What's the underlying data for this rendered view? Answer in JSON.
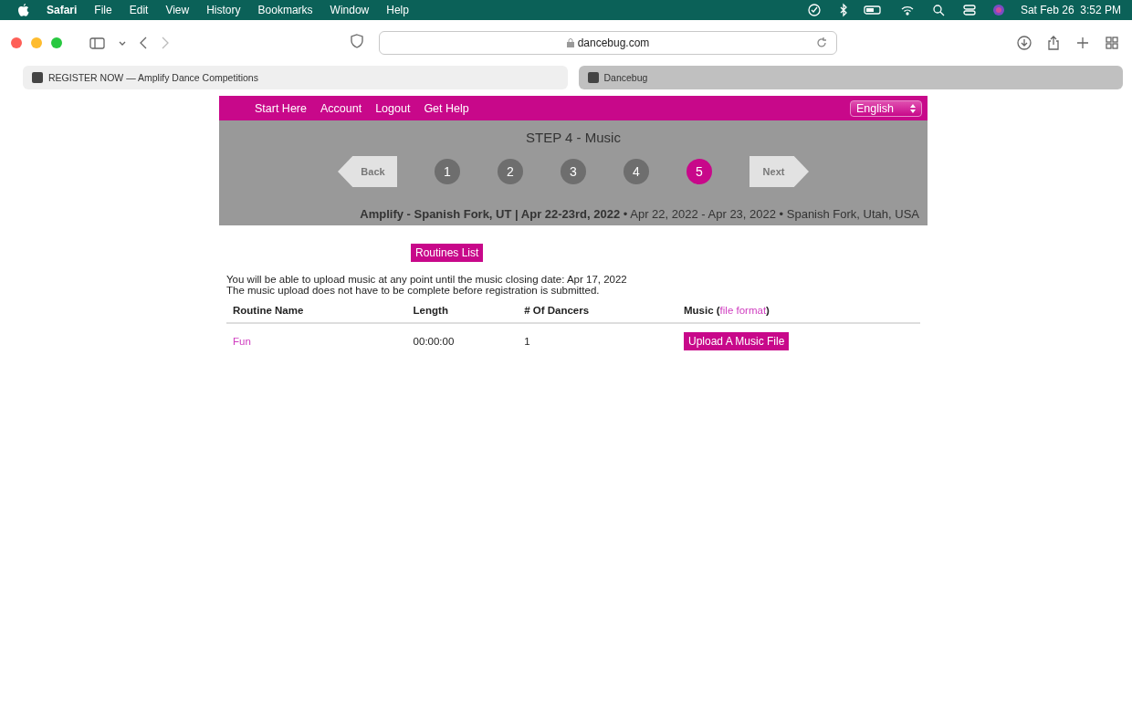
{
  "menubar": {
    "app": "Safari",
    "items": [
      "File",
      "Edit",
      "View",
      "History",
      "Bookmarks",
      "Window",
      "Help"
    ],
    "clock": "Sat Feb 26  3:52 PM"
  },
  "toolbar": {
    "url": "dancebug.com"
  },
  "tabs": [
    {
      "title": "REGISTER NOW — Amplify Dance Competitions",
      "selected": false
    },
    {
      "title": "Dancebug",
      "selected": true
    }
  ],
  "site": {
    "nav": [
      "Start Here",
      "Account",
      "Logout",
      "Get Help"
    ],
    "language": "English",
    "step_title": "STEP 4 - Music",
    "back": "Back",
    "next": "Next",
    "steps": [
      {
        "label": "1",
        "selected": false
      },
      {
        "label": "2",
        "selected": false
      },
      {
        "label": "3",
        "selected": false
      },
      {
        "label": "4",
        "selected": false
      },
      {
        "label": "5",
        "selected": true
      }
    ],
    "event": "**Amplify - Spanish Fork, UT | Apr 22-23rd, 2022** • Apr 22, 2022 - Apr 23, 2022 • Spanish Fork, Utah, USA",
    "routines_button": "Routines List",
    "notes": [
      "You will be able to upload music at any point until the music closing date: Apr 17, 2022",
      "The music upload does not have to be complete before registration is submitted."
    ],
    "columns": [
      {
        "label": "Routine Name"
      },
      {
        "label": "Length"
      },
      {
        "label": "# Of Dancers"
      },
      {
        "label": "Music (",
        "link": "file format",
        "suffix": ")"
      }
    ],
    "rows": [
      {
        "name": "Fun",
        "length": "00:00:00",
        "dancers": "1",
        "action": "Upload A Music File"
      }
    ]
  }
}
